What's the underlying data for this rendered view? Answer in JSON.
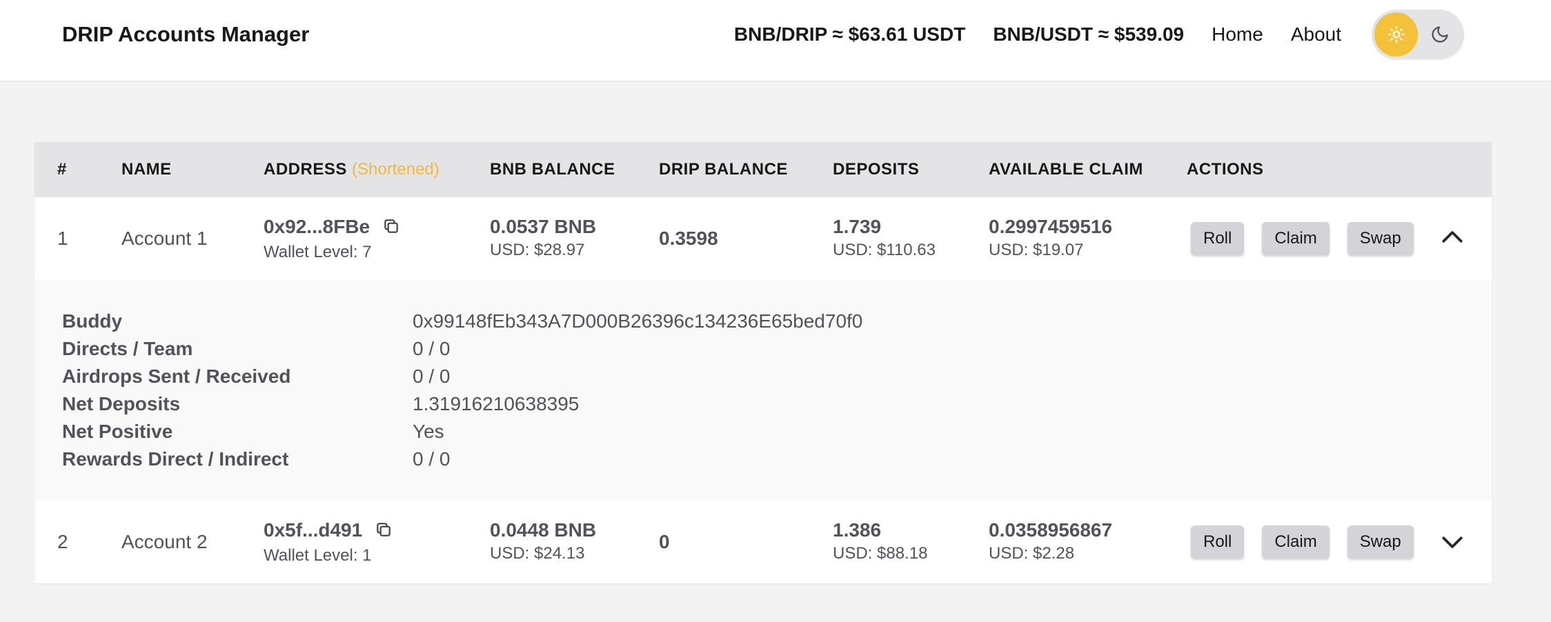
{
  "header": {
    "title": "DRIP Accounts Manager",
    "bnb_drip_price": "BNB/DRIP ≈ $63.61 USDT",
    "bnb_usdt_price": "BNB/USDT ≈ $539.09",
    "nav": {
      "home": "Home",
      "about": "About"
    },
    "theme": {
      "active": "light",
      "accent": "#f3c13a"
    }
  },
  "table": {
    "columns": {
      "index": "#",
      "name": "NAME",
      "address": "ADDRESS",
      "address_hint": "(Shortened)",
      "bnb_balance": "BNB BALANCE",
      "drip_balance": "DRIP BALANCE",
      "deposits": "DEPOSITS",
      "available_claim": "AVAILABLE CLAIM",
      "actions": "ACTIONS"
    },
    "actions": {
      "roll": "Roll",
      "claim": "Claim",
      "swap": "Swap"
    },
    "rows": [
      {
        "index": "1",
        "name": "Account 1",
        "address": "0x92...8FBe",
        "wallet_level": "Wallet Level: 7",
        "bnb": "0.0537 BNB",
        "bnb_usd": "USD: $28.97",
        "drip": "0.3598",
        "deposits": "1.739",
        "deposits_usd": "USD: $110.63",
        "claim": "0.2997459516",
        "claim_usd": "USD: $19.07",
        "expanded": true,
        "details": [
          {
            "label": "Buddy",
            "value": "0x99148fEb343A7D000B26396c134236E65bed70f0"
          },
          {
            "label": "Directs / Team",
            "value": "0 / 0"
          },
          {
            "label": "Airdrops Sent / Received",
            "value": "0 / 0"
          },
          {
            "label": "Net Deposits",
            "value": "1.31916210638395"
          },
          {
            "label": "Net Positive",
            "value": "Yes"
          },
          {
            "label": "Rewards Direct / Indirect",
            "value": "0 / 0"
          }
        ]
      },
      {
        "index": "2",
        "name": "Account 2",
        "address": "0x5f...d491",
        "wallet_level": "Wallet Level: 1",
        "bnb": "0.0448 BNB",
        "bnb_usd": "USD: $24.13",
        "drip": "0",
        "deposits": "1.386",
        "deposits_usd": "USD: $88.18",
        "claim": "0.0358956867",
        "claim_usd": "USD: $2.28",
        "expanded": false
      }
    ]
  }
}
